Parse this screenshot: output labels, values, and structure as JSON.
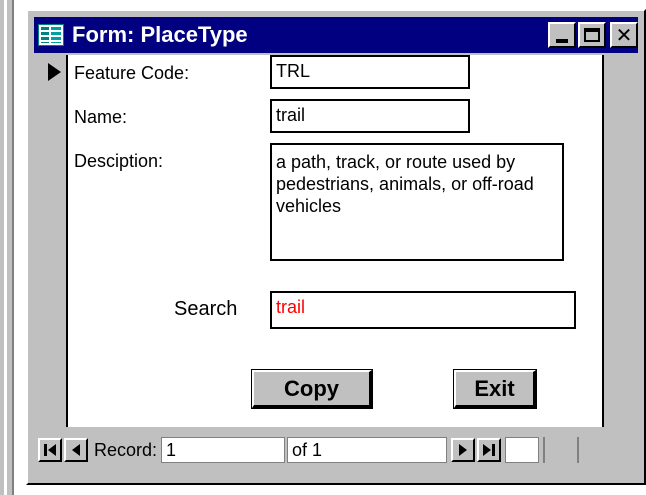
{
  "window": {
    "title": "Form: PlaceType",
    "titlebar_color": "#000080",
    "buttons": {
      "minimize": "_",
      "maximize": "□",
      "close": "✕"
    }
  },
  "fields": {
    "feature_code": {
      "label": "Feature Code:",
      "value": "TRL"
    },
    "name": {
      "label": "Name:",
      "value": "trail"
    },
    "description": {
      "label": "Desciption:",
      "value": "a path, track, or route used by pedestrians, animals, or off-road vehicles"
    },
    "search": {
      "label": "Search",
      "value": "trail",
      "text_color": "#ff0000"
    }
  },
  "buttons": {
    "copy": "Copy",
    "exit": "Exit"
  },
  "navigation": {
    "record_label": "Record:",
    "current_record": "1",
    "of_label": "of  1"
  },
  "icons": {
    "form": "form-icon",
    "record_selector": "record-pointer-icon",
    "first": "first-record-icon",
    "prev": "previous-record-icon",
    "next": "next-record-icon",
    "last": "last-record-icon"
  }
}
